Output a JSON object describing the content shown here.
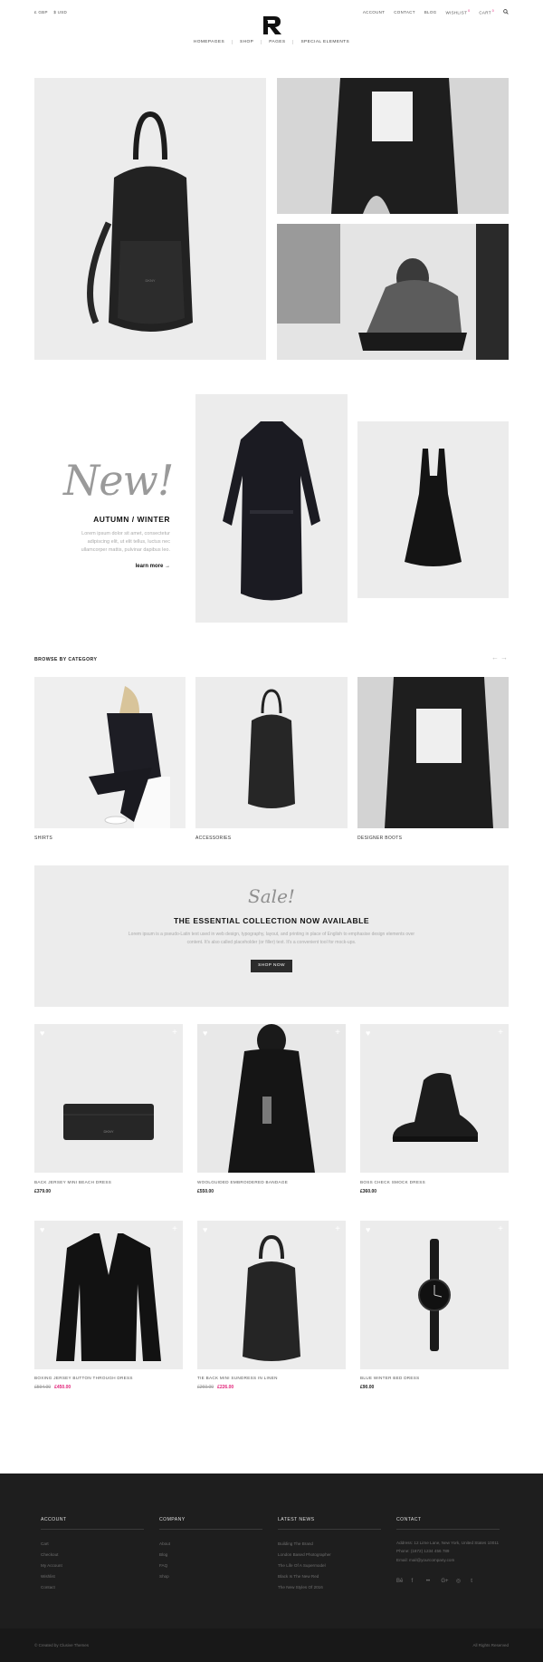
{
  "header": {
    "currencies": [
      "£ GBP",
      "$ USD"
    ],
    "toplinks": [
      {
        "label": "ACCOUNT",
        "badge": ""
      },
      {
        "label": "CONTACT",
        "badge": ""
      },
      {
        "label": "BLOG",
        "badge": ""
      },
      {
        "label": "WISHLIST",
        "badge": "0"
      },
      {
        "label": "CART",
        "badge": "0"
      }
    ],
    "nav": [
      "HOMEPAGES",
      "SHOP",
      "PAGES",
      "SPECIAL ELEMENTS"
    ]
  },
  "promo": {
    "script": "New!",
    "title": "AUTUMN / WINTER",
    "text": "Lorem ipsum dolor sit amet, consectetur adipiscing elit, ut elit tellus, luctus nec ullamcorper mattis, pulvinar dapibus leo.",
    "link": "learn more →"
  },
  "categories": {
    "title": "BROWSE BY CATEGORY",
    "items": [
      "SHIRTS",
      "ACCESSORIES",
      "DESIGNER BOOTS"
    ]
  },
  "sale": {
    "script": "Sale!",
    "title": "THE ESSENTIAL COLLECTION NOW AVAILABLE",
    "text": "Lorem ipsum is a pseudo-Latin text used in web design, typography, layout, and printing in place of English to emphasise design elements over content. It's also called placeholder (or filler) text. It's a convenient tool for mock-ups.",
    "button": "SHOP NOW"
  },
  "products": [
    {
      "name": "BACK JERSEY MINI BEACH DRESS",
      "old": "",
      "price": "£379.00"
    },
    {
      "name": "WOOLGUIDED EMBROIDERED BANDAGE",
      "old": "",
      "price": "£550.00"
    },
    {
      "name": "BOSS CHECK SMOCK DRESS",
      "old": "",
      "price": "£360.00"
    },
    {
      "name": "BOXING JERSEY BUTTON THROUGH DRESS",
      "old": "£594.00",
      "price": "£450.00"
    },
    {
      "name": "TIE BACK MINI SUNDRESS IN LINEN",
      "old": "£260.00",
      "price": "£226.00"
    },
    {
      "name": "BLUE WINTER BED DRESS",
      "old": "",
      "price": "£90.00"
    }
  ],
  "footer": {
    "account": {
      "title": "ACCOUNT",
      "links": [
        "Cart",
        "Checkout",
        "My Account",
        "Wishlist",
        "Contact"
      ]
    },
    "company": {
      "title": "COMPANY",
      "links": [
        "About",
        "Blog",
        "FAQ",
        "Shop"
      ]
    },
    "news": {
      "title": "LATEST NEWS",
      "links": [
        "Building The Brand",
        "London Based Photographer",
        "The Life Of A Supermodel",
        "Black Is The New Red",
        "The New Styles Of 2016"
      ]
    },
    "contact": {
      "title": "CONTACT",
      "address": "Address: 12 Lime Lane, New York, United States 10011",
      "phone": "Phone: (1872) 1234 456 789",
      "email": "Email: mail@yourcompany.com",
      "social": [
        "behance-icon",
        "facebook-icon",
        "flickr-icon",
        "google-plus-icon",
        "instagram-icon",
        "twitter-icon"
      ]
    },
    "copyright": "© Created by Clusive Themes",
    "rights": "All Rights Reserved"
  },
  "colors": {
    "accent": "#e2247a",
    "footer_bg": "#1e1e1e",
    "panel_bg": "#ececec"
  }
}
